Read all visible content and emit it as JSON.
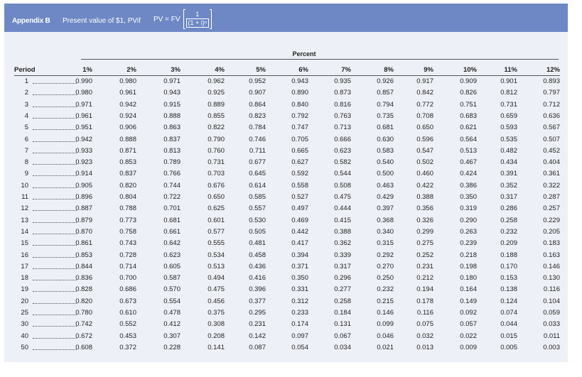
{
  "header": {
    "label": "Appendix B",
    "title": "Present value of $1, PVif",
    "formula_lhs": "PV = FV",
    "formula_num": "1",
    "formula_den": "(1 + i)ⁿ"
  },
  "table": {
    "group_label": "Percent",
    "period_label": "Period",
    "columns": [
      "1%",
      "2%",
      "3%",
      "4%",
      "5%",
      "6%",
      "7%",
      "8%",
      "9%",
      "10%",
      "11%",
      "12%"
    ],
    "rows": [
      {
        "period": "1",
        "values": [
          "0.990",
          "0.980",
          "0.971",
          "0.962",
          "0.952",
          "0.943",
          "0.935",
          "0.926",
          "0.917",
          "0.909",
          "0.901",
          "0.893"
        ]
      },
      {
        "period": "2",
        "values": [
          "0.980",
          "0.961",
          "0.943",
          "0.925",
          "0.907",
          "0.890",
          "0.873",
          "0.857",
          "0.842",
          "0.826",
          "0.812",
          "0.797"
        ]
      },
      {
        "period": "3",
        "values": [
          "0.971",
          "0.942",
          "0.915",
          "0.889",
          "0.864",
          "0.840",
          "0.816",
          "0.794",
          "0.772",
          "0.751",
          "0.731",
          "0.712"
        ]
      },
      {
        "period": "4",
        "values": [
          "0.961",
          "0.924",
          "0.888",
          "0.855",
          "0.823",
          "0.792",
          "0.763",
          "0.735",
          "0.708",
          "0.683",
          "0.659",
          "0.636"
        ]
      },
      {
        "period": "5",
        "values": [
          "0.951",
          "0.906",
          "0.863",
          "0.822",
          "0.784",
          "0.747",
          "0.713",
          "0.681",
          "0.650",
          "0.621",
          "0.593",
          "0.567"
        ]
      },
      {
        "period": "6",
        "values": [
          "0.942",
          "0.888",
          "0.837",
          "0.790",
          "0.746",
          "0.705",
          "0.666",
          "0.630",
          "0.596",
          "0.564",
          "0.535",
          "0.507"
        ]
      },
      {
        "period": "7",
        "values": [
          "0.933",
          "0.871",
          "0.813",
          "0.760",
          "0.711",
          "0.665",
          "0.623",
          "0.583",
          "0.547",
          "0.513",
          "0.482",
          "0.452"
        ]
      },
      {
        "period": "8",
        "values": [
          "0.923",
          "0.853",
          "0.789",
          "0.731",
          "0.677",
          "0.627",
          "0.582",
          "0.540",
          "0.502",
          "0.467",
          "0.434",
          "0.404"
        ]
      },
      {
        "period": "9",
        "values": [
          "0.914",
          "0.837",
          "0.766",
          "0.703",
          "0.645",
          "0.592",
          "0.544",
          "0.500",
          "0.460",
          "0.424",
          "0.391",
          "0.361"
        ]
      },
      {
        "period": "10",
        "values": [
          "0.905",
          "0.820",
          "0.744",
          "0.676",
          "0.614",
          "0.558",
          "0.508",
          "0.463",
          "0.422",
          "0.386",
          "0.352",
          "0.322"
        ]
      },
      {
        "period": "11",
        "values": [
          "0.896",
          "0.804",
          "0.722",
          "0.650",
          "0.585",
          "0.527",
          "0.475",
          "0.429",
          "0.388",
          "0.350",
          "0.317",
          "0.287"
        ]
      },
      {
        "period": "12",
        "values": [
          "0.887",
          "0.788",
          "0.701",
          "0.625",
          "0.557",
          "0.497",
          "0.444",
          "0.397",
          "0.356",
          "0.319",
          "0.286",
          "0.257"
        ]
      },
      {
        "period": "13",
        "values": [
          "0.879",
          "0.773",
          "0.681",
          "0.601",
          "0.530",
          "0.469",
          "0.415",
          "0.368",
          "0.326",
          "0.290",
          "0.258",
          "0.229"
        ]
      },
      {
        "period": "14",
        "values": [
          "0.870",
          "0.758",
          "0.661",
          "0.577",
          "0.505",
          "0.442",
          "0.388",
          "0.340",
          "0.299",
          "0.263",
          "0.232",
          "0.205"
        ]
      },
      {
        "period": "15",
        "values": [
          "0.861",
          "0.743",
          "0.642",
          "0.555",
          "0.481",
          "0.417",
          "0.362",
          "0.315",
          "0.275",
          "0.239",
          "0.209",
          "0.183"
        ]
      },
      {
        "period": "16",
        "values": [
          "0.853",
          "0.728",
          "0.623",
          "0.534",
          "0.458",
          "0.394",
          "0.339",
          "0.292",
          "0.252",
          "0.218",
          "0.188",
          "0.163"
        ]
      },
      {
        "period": "17",
        "values": [
          "0.844",
          "0.714",
          "0.605",
          "0.513",
          "0.436",
          "0.371",
          "0.317",
          "0.270",
          "0.231",
          "0.198",
          "0.170",
          "0.146"
        ]
      },
      {
        "period": "18",
        "values": [
          "0.836",
          "0.700",
          "0.587",
          "0.494",
          "0.416",
          "0.350",
          "0.296",
          "0.250",
          "0.212",
          "0.180",
          "0.153",
          "0.130"
        ]
      },
      {
        "period": "19",
        "values": [
          "0.828",
          "0.686",
          "0.570",
          "0.475",
          "0.396",
          "0.331",
          "0.277",
          "0.232",
          "0.194",
          "0.164",
          "0.138",
          "0.116"
        ]
      },
      {
        "period": "20",
        "values": [
          "0.820",
          "0.673",
          "0.554",
          "0.456",
          "0.377",
          "0.312",
          "0.258",
          "0.215",
          "0.178",
          "0.149",
          "0.124",
          "0.104"
        ]
      },
      {
        "period": "25",
        "values": [
          "0.780",
          "0.610",
          "0.478",
          "0.375",
          "0.295",
          "0.233",
          "0.184",
          "0.146",
          "0.116",
          "0.092",
          "0.074",
          "0.059"
        ]
      },
      {
        "period": "30",
        "values": [
          "0.742",
          "0.552",
          "0.412",
          "0.308",
          "0.231",
          "0.174",
          "0.131",
          "0.099",
          "0.075",
          "0.057",
          "0.044",
          "0.033"
        ]
      },
      {
        "period": "40",
        "values": [
          "0.672",
          "0.453",
          "0.307",
          "0.208",
          "0.142",
          "0.097",
          "0.067",
          "0.046",
          "0.032",
          "0.022",
          "0.015",
          "0.011"
        ]
      },
      {
        "period": "50",
        "values": [
          "0.608",
          "0.372",
          "0.228",
          "0.141",
          "0.087",
          "0.054",
          "0.034",
          "0.021",
          "0.013",
          "0.009",
          "0.005",
          "0.003"
        ]
      }
    ]
  }
}
